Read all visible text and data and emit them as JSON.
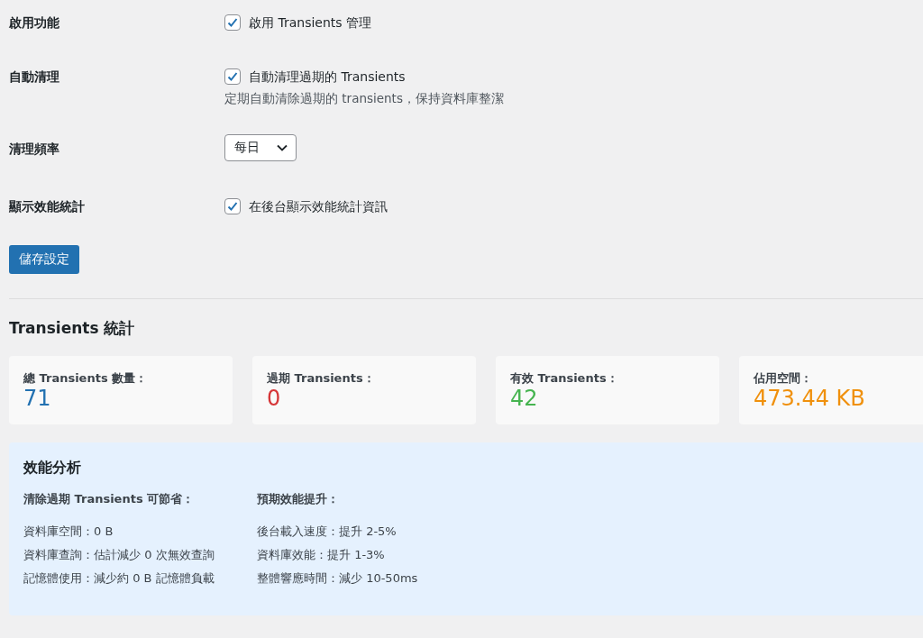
{
  "settings": [
    {
      "kind": "checkbox",
      "label": "啟用功能",
      "option": "啟用 Transients 管理",
      "checked": true
    },
    {
      "kind": "checkbox",
      "label": "自動清理",
      "option": "自動清理過期的 Transients",
      "checked": true,
      "description": "定期自動清除過期的 transients，保持資料庫整潔"
    },
    {
      "kind": "select",
      "label": "清理頻率",
      "value": "每日"
    },
    {
      "kind": "checkbox",
      "label": "顯示效能統計",
      "option": "在後台顯示效能統計資訊",
      "checked": true
    }
  ],
  "save_button": "儲存設定",
  "stats": {
    "title": "Transients 統計",
    "cards": [
      {
        "label": "總 Transients 數量：",
        "value": "71",
        "color": "#2271b1"
      },
      {
        "label": "過期 Transients：",
        "value": "0",
        "color": "#d63638"
      },
      {
        "label": "有效 Transients：",
        "value": "42",
        "color": "#46b450"
      },
      {
        "label": "佔用空間：",
        "value": "473.44 KB",
        "color": "#f0900c"
      }
    ]
  },
  "analysis": {
    "title": "效能分析",
    "columns": [
      {
        "heading": "清除過期 Transients 可節省：",
        "lines": [
          "資料庫空間：0 B",
          "資料庫查詢：估計減少 0 次無效查詢",
          "記憶體使用：減少約 0 B 記憶體負載"
        ]
      },
      {
        "heading": "預期效能提升：",
        "lines": [
          "後台載入速度：提升 2-5%",
          "資料庫效能：提升 1-3%",
          "整體響應時間：減少 10-50ms"
        ]
      }
    ]
  }
}
